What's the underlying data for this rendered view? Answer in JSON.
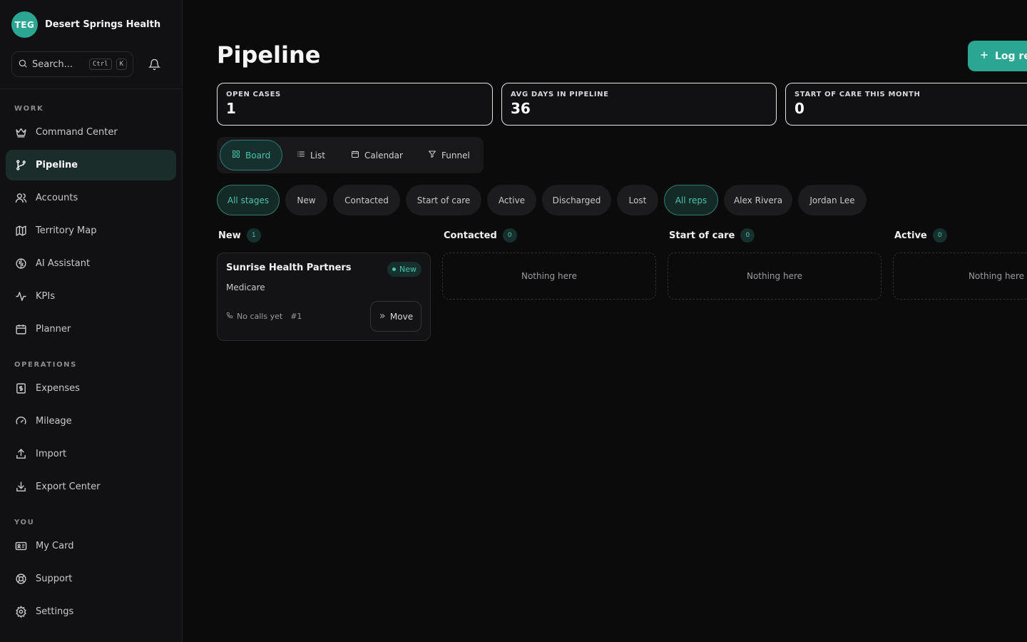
{
  "brand": {
    "logo_text": "TEG",
    "name": "Desert Springs Health"
  },
  "search": {
    "placeholder": "Search...",
    "shortcut_ctrl": "Ctrl",
    "shortcut_key": "K"
  },
  "sidebar": {
    "sections": [
      {
        "title": "WORK"
      },
      {
        "title": "OPERATIONS"
      },
      {
        "title": "YOU"
      }
    ],
    "items": [
      {
        "label": "Command Center",
        "icon": "crown-icon"
      },
      {
        "label": "Pipeline",
        "icon": "branch-icon",
        "active": true
      },
      {
        "label": "Accounts",
        "icon": "users-icon"
      },
      {
        "label": "Territory Map",
        "icon": "map-icon"
      },
      {
        "label": "AI Assistant",
        "icon": "brain-icon"
      },
      {
        "label": "KPIs",
        "icon": "activity-icon"
      },
      {
        "label": "Planner",
        "icon": "calendar-icon"
      },
      {
        "label": "Expenses",
        "icon": "receipt-icon"
      },
      {
        "label": "Mileage",
        "icon": "gauge-icon"
      },
      {
        "label": "Import",
        "icon": "upload-icon"
      },
      {
        "label": "Export Center",
        "icon": "download-icon"
      },
      {
        "label": "My Card",
        "icon": "id-card-icon"
      },
      {
        "label": "Support",
        "icon": "lifebuoy-icon"
      },
      {
        "label": "Settings",
        "icon": "gear-icon"
      }
    ]
  },
  "main": {
    "title": "Pipeline",
    "log_button": "Log ref",
    "stats": [
      {
        "label": "OPEN CASES",
        "value": "1"
      },
      {
        "label": "AVG DAYS IN PIPELINE",
        "value": "36"
      },
      {
        "label": "START OF CARE THIS MONTH",
        "value": "0"
      }
    ],
    "view_tabs": [
      {
        "label": "Board",
        "icon": "grid-icon",
        "active": true
      },
      {
        "label": "List",
        "icon": "list-icon"
      },
      {
        "label": "Calendar",
        "icon": "calendar-icon"
      },
      {
        "label": "Funnel",
        "icon": "filter-icon"
      }
    ],
    "stage_filters": [
      "All stages",
      "New",
      "Contacted",
      "Start of care",
      "Active",
      "Discharged",
      "Lost"
    ],
    "rep_filters": [
      "All reps",
      "Alex Rivera",
      "Jordan Lee"
    ],
    "columns": [
      {
        "name": "New",
        "count": "1"
      },
      {
        "name": "Contacted",
        "count": "0",
        "empty_text": "Nothing here"
      },
      {
        "name": "Start of care",
        "count": "0",
        "empty_text": "Nothing here"
      },
      {
        "name": "Active",
        "count": "0",
        "empty_text": "Nothing here"
      }
    ],
    "card": {
      "title": "Sunrise Health Partners",
      "badge": "New",
      "subtitle": "Medicare",
      "calls": "No calls yet",
      "number": "#1",
      "move_label": "Move"
    }
  },
  "colors": {
    "accent": "#2aa693",
    "background": "#0b0b0c",
    "sidebar": "#111113"
  }
}
